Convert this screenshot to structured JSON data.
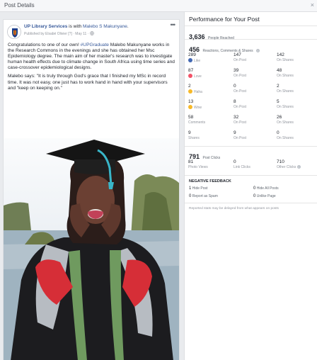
{
  "dialog": {
    "title": "Post Details",
    "close_glyph": "×"
  },
  "post": {
    "author": "UP Library Services",
    "is_with": "is with",
    "tagged": "Malebo S Makunyane",
    "published_by": "Published by Elsabé Olivier",
    "published_by_suffix": "[?]",
    "date": "May 11",
    "privacy_icon": "globe-icon",
    "more_glyph": "•••",
    "para1_a": "Congratulations to one of our own! ",
    "para1_tag": "#UPGraduate",
    "para1_b": " Malebo Makunyane works in the Research Commons in the evenings and she has obtained her Msc Epidemiology degree. The main aim of her master's research was to investigate human health effects due to climate change in South Africa using time series and case-crossover epidemiological designs.",
    "para2": "Malebo says: \"It is truly through God's grace that I finished my MSc in record time. It was not easy, one just has to work hand in hand with your supervisors and \"keep on keeping on.\""
  },
  "performance": {
    "title": "Performance for Your Post",
    "people_reached": "3,636",
    "people_reached_label": "People Reached",
    "reactions_total": "456",
    "reactions_label": "Reactions, Comments & Shares",
    "rows": [
      {
        "icon": "like-icon",
        "color": "#4267b2",
        "total": "289",
        "label": "Like",
        "on_post": "147",
        "on_shares": "142"
      },
      {
        "icon": "love-icon",
        "color": "#f25268",
        "total": "87",
        "label": "Love",
        "on_post": "39",
        "on_shares": "48"
      },
      {
        "icon": "haha-icon",
        "color": "#f7b928",
        "total": "2",
        "label": "Haha",
        "on_post": "0",
        "on_shares": "2"
      },
      {
        "icon": "wow-icon",
        "color": "#f7b928",
        "total": "13",
        "label": "Wow",
        "on_post": "8",
        "on_shares": "5"
      },
      {
        "icon": "",
        "color": "",
        "total": "58",
        "label": "Comments",
        "on_post": "32",
        "on_shares": "26"
      },
      {
        "icon": "",
        "color": "",
        "total": "9",
        "label": "Shares",
        "on_post": "9",
        "on_shares": "0"
      }
    ],
    "on_post_label": "On Post",
    "on_shares_label": "On Shares",
    "post_clicks": "791",
    "post_clicks_label": "Post Clicks",
    "clicks": [
      {
        "value": "81",
        "label": "Photo Views"
      },
      {
        "value": "0",
        "label": "Link Clicks"
      },
      {
        "value": "710",
        "label": "Other Clicks",
        "info": "i"
      }
    ],
    "negative_title": "NEGATIVE FEEDBACK",
    "negative": [
      {
        "value": "1",
        "label": "Hide Post"
      },
      {
        "value": "0",
        "label": "Hide All Posts"
      },
      {
        "value": "0",
        "label": "Report as Spam"
      },
      {
        "value": "0",
        "label": "Unlike Page"
      }
    ],
    "footer": "Reported stats may be delayed from what appears on posts"
  }
}
